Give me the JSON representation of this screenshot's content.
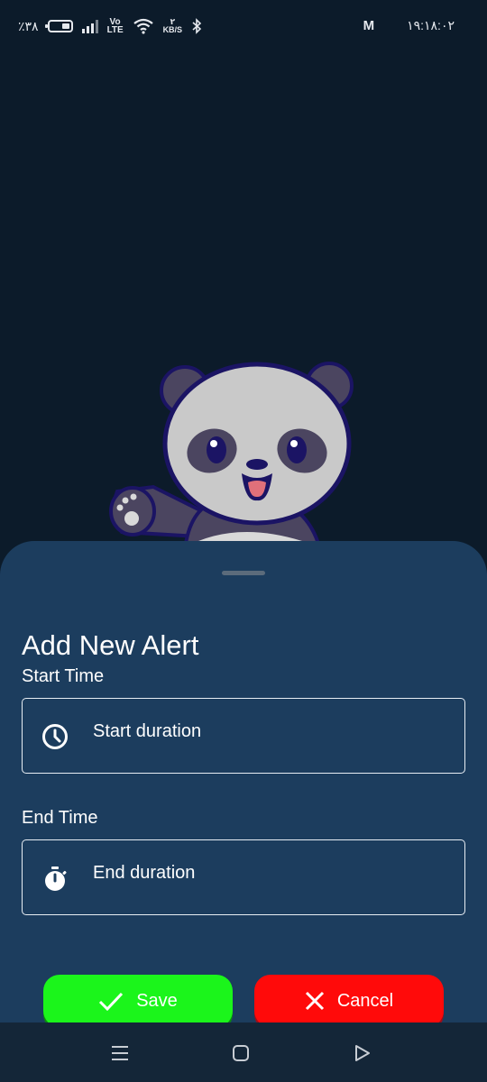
{
  "status_bar": {
    "battery": "٪۳۸",
    "network": "Vo LTE",
    "speed_value": "۲",
    "speed_unit": "KB/S",
    "mail_icon": "M",
    "time": "۱۹:۱۸:۰۲"
  },
  "sheet": {
    "title": "Add New Alert",
    "start": {
      "label": "Start Time",
      "placeholder": "Start duration",
      "icon": "clock-icon"
    },
    "end": {
      "label": "End Time",
      "placeholder": "End duration",
      "icon": "stopwatch-icon"
    }
  },
  "actions": {
    "save_label": "Save",
    "cancel_label": "Cancel"
  },
  "colors": {
    "background": "#0c1b2a",
    "sheet": "#1c3d5e",
    "save": "#1bf51b",
    "cancel": "#ff0a0a"
  },
  "nav": {
    "menu_icon": "menu-icon",
    "home_icon": "home-icon",
    "back_icon": "back-icon"
  }
}
